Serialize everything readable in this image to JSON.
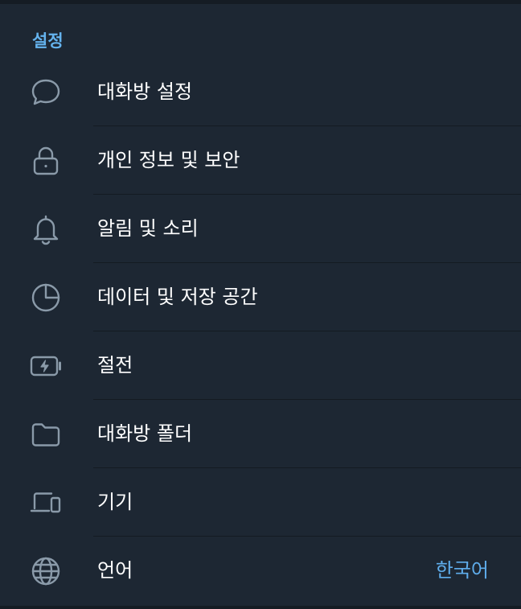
{
  "section": {
    "title": "설정"
  },
  "items": [
    {
      "label": "대화방 설정",
      "icon": "chat-bubble-icon"
    },
    {
      "label": "개인 정보 및 보안",
      "icon": "lock-icon"
    },
    {
      "label": "알림 및 소리",
      "icon": "bell-icon"
    },
    {
      "label": "데이터 및 저장 공간",
      "icon": "pie-chart-icon"
    },
    {
      "label": "절전",
      "icon": "battery-bolt-icon"
    },
    {
      "label": "대화방 폴더",
      "icon": "folder-icon"
    },
    {
      "label": "기기",
      "icon": "devices-icon"
    },
    {
      "label": "언어",
      "icon": "globe-icon",
      "value": "한국어"
    }
  ],
  "colors": {
    "background": "#1d2733",
    "accent": "#64b3ee",
    "icon": "#8a9aa9",
    "text": "#ffffff",
    "divider": "#141b22"
  }
}
